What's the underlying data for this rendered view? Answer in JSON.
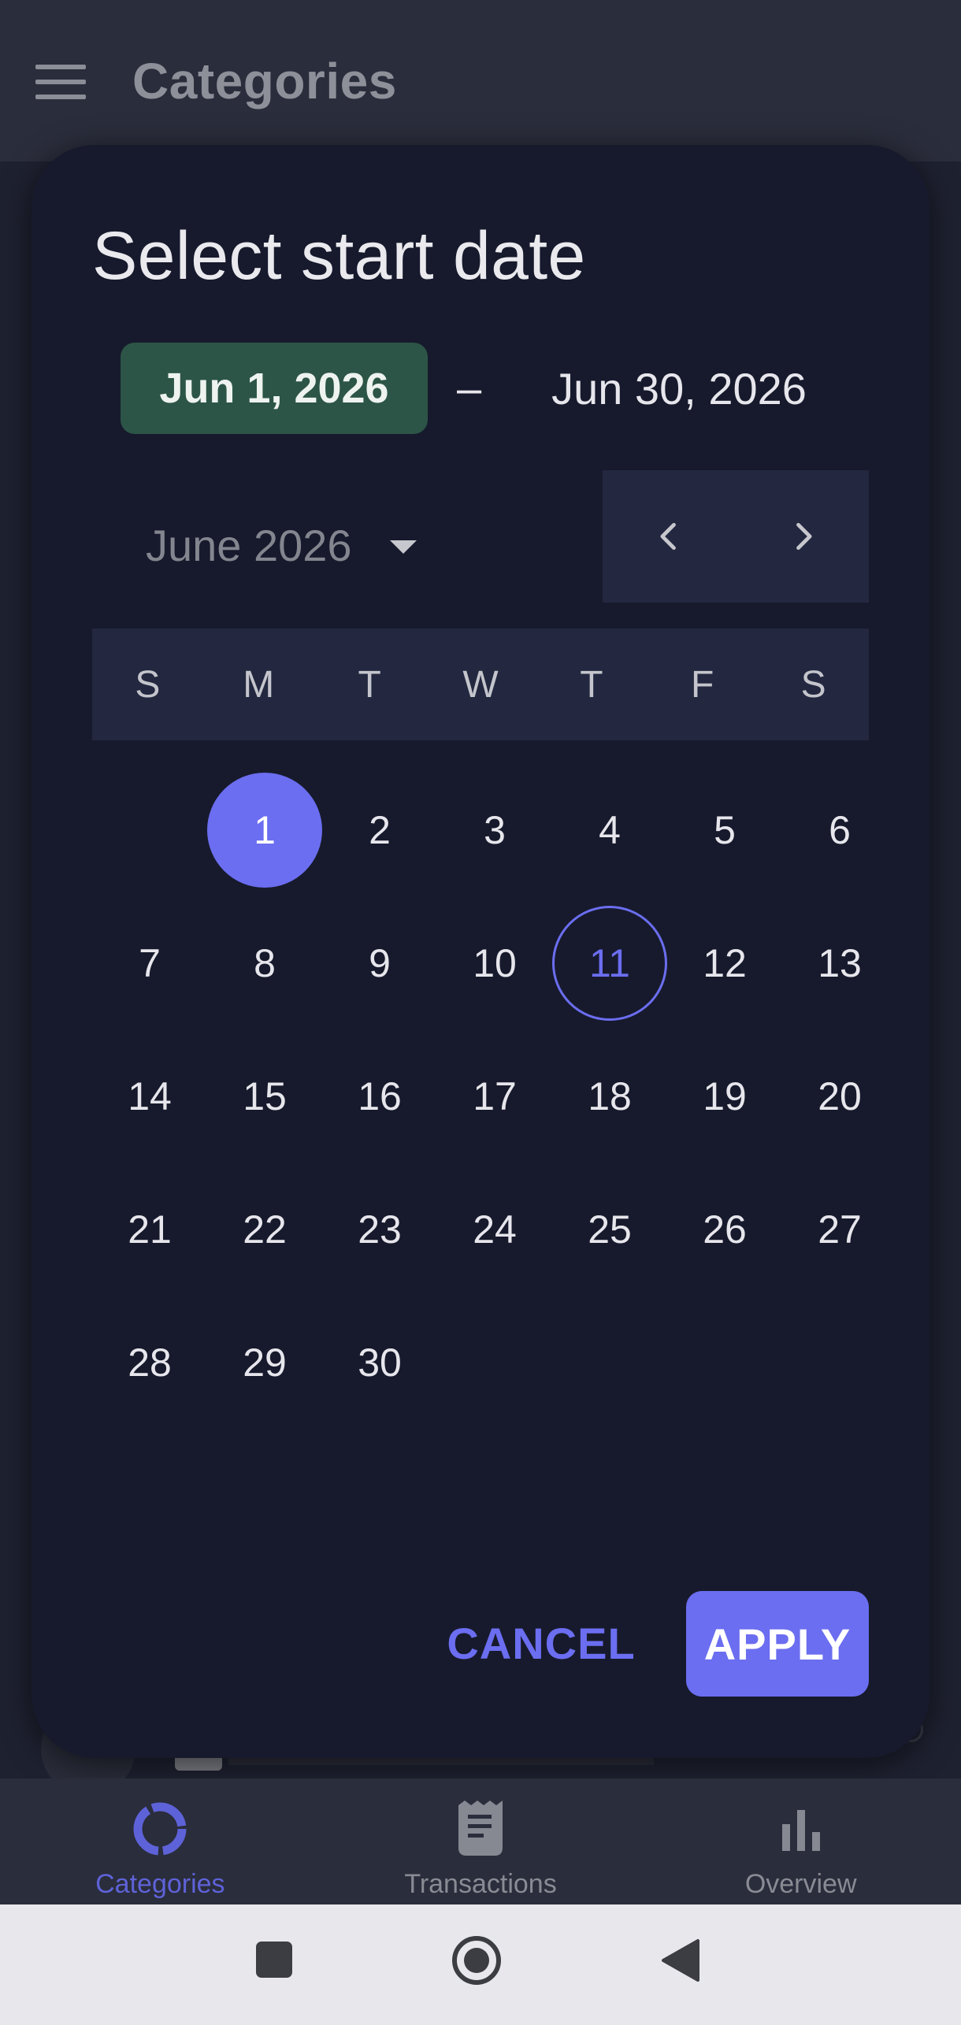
{
  "app": {
    "title": "Categories"
  },
  "dialog": {
    "title": "Select start date",
    "start_date": "Jun 1, 2026",
    "dash": "–",
    "end_date": "Jun 30, 2026",
    "month_label": "June 2026",
    "weekdays": [
      "S",
      "M",
      "T",
      "W",
      "T",
      "F",
      "S"
    ],
    "days": [
      "",
      "1",
      "2",
      "3",
      "4",
      "5",
      "6",
      "7",
      "8",
      "9",
      "10",
      "11",
      "12",
      "13",
      "14",
      "15",
      "16",
      "17",
      "18",
      "19",
      "20",
      "21",
      "22",
      "23",
      "24",
      "25",
      "26",
      "27",
      "28",
      "29",
      "30",
      "",
      "",
      "",
      ""
    ],
    "selected_day": "1",
    "today_day": "11",
    "cancel_label": "CANCEL",
    "apply_label": "APPLY"
  },
  "bottom_nav": {
    "items": [
      {
        "label": "Categories",
        "icon": "donut-chart-icon",
        "active": true
      },
      {
        "label": "Transactions",
        "icon": "receipt-icon",
        "active": false
      },
      {
        "label": "Overview",
        "icon": "bar-chart-icon",
        "active": false
      }
    ]
  },
  "colors": {
    "accent": "#6b6ef0",
    "start_chip": "#2c5547",
    "dialog_bg": "#171a2c",
    "header_bg": "#232840"
  }
}
